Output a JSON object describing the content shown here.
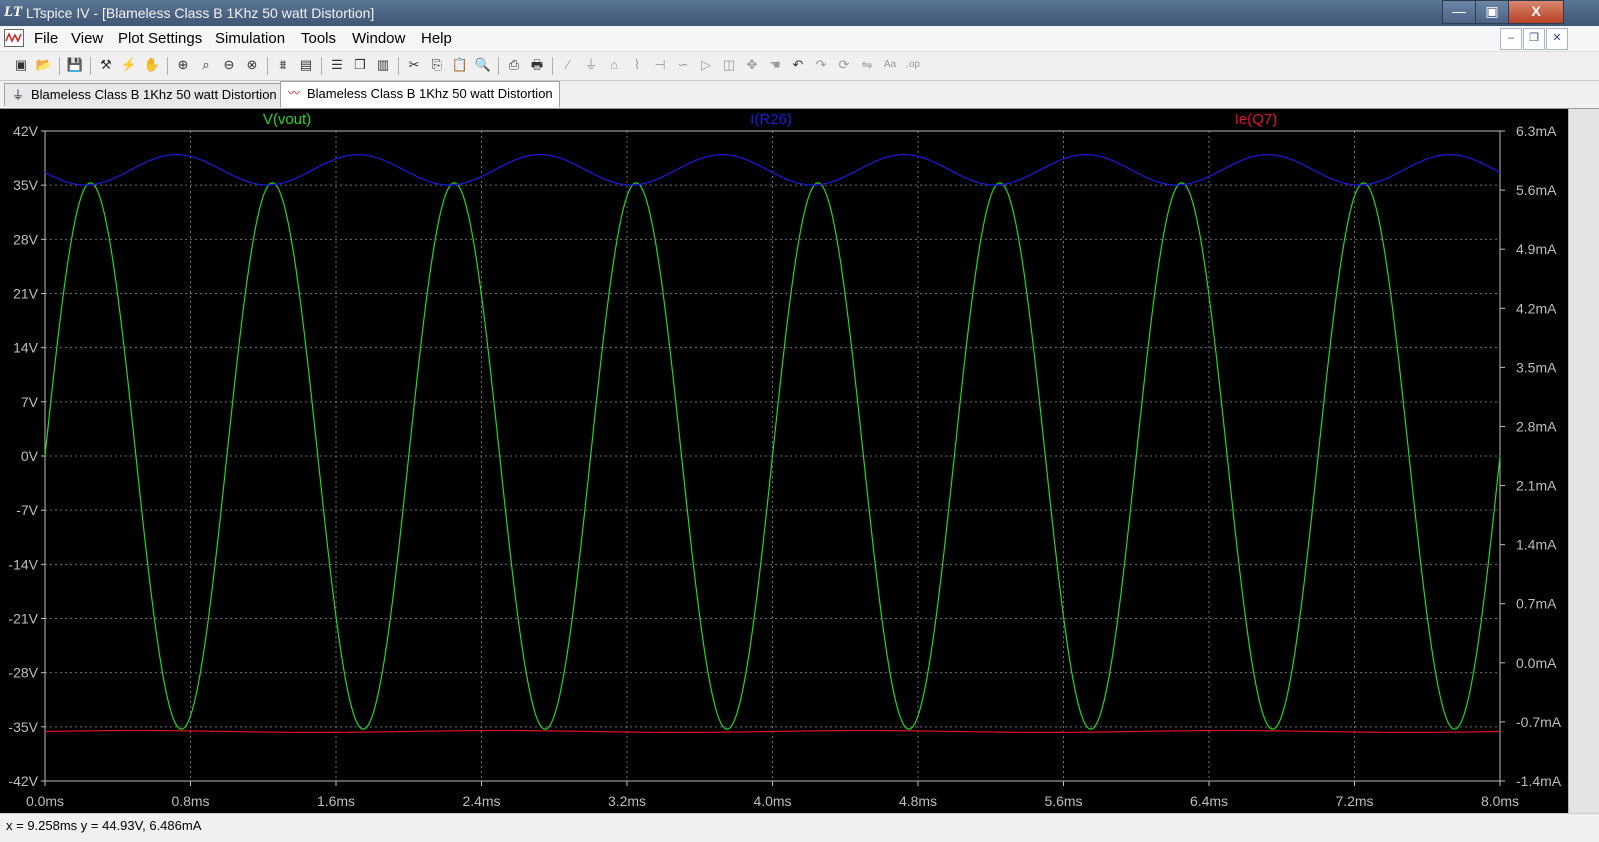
{
  "window": {
    "logo": "LT",
    "title": "LTspice IV - [Blameless Class B 1Khz 50 watt Distortion]",
    "minimize": "—",
    "maximize": "▣",
    "close": "X"
  },
  "menu": [
    "File",
    "View",
    "Plot Settings",
    "Simulation",
    "Tools",
    "Window",
    "Help"
  ],
  "mdi": {
    "minimize": "–",
    "restore": "❐",
    "close": "✕"
  },
  "toolbar": [
    "new-schematic-icon",
    "open-icon",
    "save-icon",
    "control-panel-icon",
    "run-icon",
    "pan-hand-icon",
    "zoom-in-icon",
    "zoom-box-icon",
    "zoom-out-icon",
    "zoom-cancel-icon",
    "autorange-icon",
    "view-spice-icon",
    "tile-horizontal-icon",
    "cascade-icon",
    "tile-vertical-icon",
    "cut-icon",
    "copy-icon",
    "paste-icon",
    "find-icon",
    "print-preview-icon",
    "print-icon",
    "wire-icon",
    "ground-icon",
    "label-icon",
    "resistor-icon",
    "capacitor-icon",
    "inductor-icon",
    "diode-icon",
    "component-icon",
    "move-icon",
    "drag-icon",
    "undo-icon",
    "redo-icon",
    "rotate-icon",
    "mirror-icon",
    "text-icon",
    "spice-directive-icon"
  ],
  "tabs": [
    {
      "label": "Blameless Class B 1Khz 50 watt Distortion",
      "icon": "schematic-icon",
      "active": false
    },
    {
      "label": "Blameless Class B 1Khz 50 watt Distortion",
      "icon": "waveform-icon",
      "active": true
    }
  ],
  "status": "x = 9.258ms    y = 44.93V, 6.486mA",
  "colors": {
    "vout": "#22d622",
    "ir26": "#1a1add",
    "ieq7": "#e0102a",
    "grid": "#6e6e6e",
    "axis": "#bdbdbd",
    "background": "#000000"
  },
  "chart_data": {
    "type": "line",
    "title": "",
    "x_axis": {
      "label": "",
      "unit": "ms",
      "range": [
        0,
        8.0
      ],
      "ticks": [
        "0.0ms",
        "0.8ms",
        "1.6ms",
        "2.4ms",
        "3.2ms",
        "4.0ms",
        "4.8ms",
        "5.6ms",
        "6.4ms",
        "7.2ms",
        "8.0ms"
      ]
    },
    "y_left": {
      "unit": "V",
      "range": [
        -42,
        42
      ],
      "ticks": [
        "42V",
        "35V",
        "28V",
        "21V",
        "14V",
        "7V",
        "0V",
        "-7V",
        "-14V",
        "-21V",
        "-28V",
        "-35V",
        "-42V"
      ]
    },
    "y_right": {
      "unit": "mA",
      "range": [
        -1.4,
        6.3
      ],
      "ticks": [
        "6.3mA",
        "5.6mA",
        "4.9mA",
        "4.2mA",
        "3.5mA",
        "2.8mA",
        "2.1mA",
        "1.4mA",
        "0.7mA",
        "0.0mA",
        "-0.7mA",
        "-1.4mA"
      ]
    },
    "grid": true,
    "legend_position": "top",
    "series": [
      {
        "name": "V(vout)",
        "axis": "left",
        "waveform": "sine",
        "frequency_khz": 1.0,
        "amplitude_v": 35.3,
        "offset_v": 0.0,
        "phase_deg": 0
      },
      {
        "name": "I(R26)",
        "axis": "right",
        "waveform": "sine",
        "frequency_khz": 1.0,
        "center_ma": 5.84,
        "amplitude_ma": 0.18,
        "phase_deg": 190
      },
      {
        "name": "Ie(Q7)",
        "axis": "left",
        "waveform": "flat",
        "value_v": -35.6
      }
    ]
  }
}
